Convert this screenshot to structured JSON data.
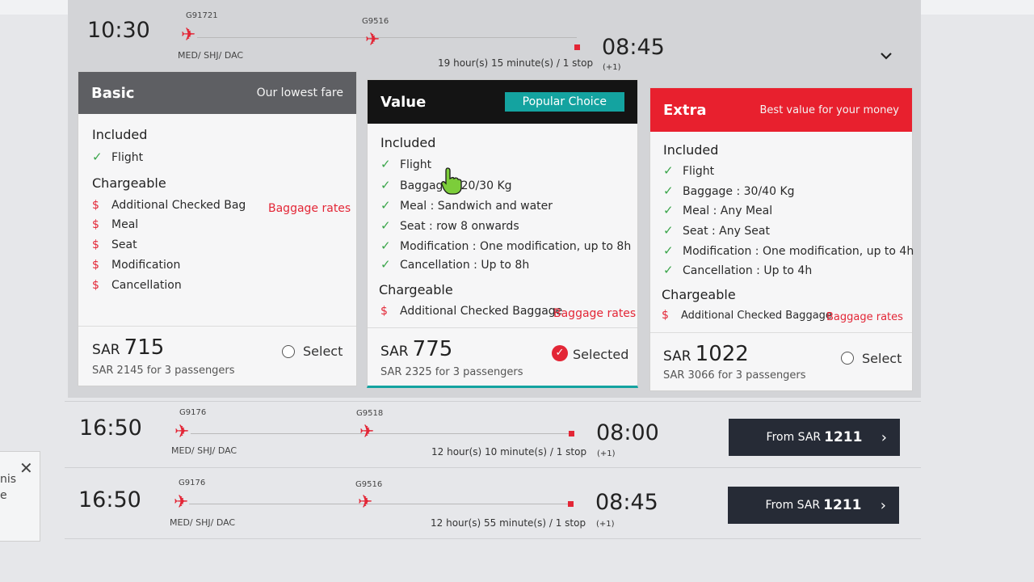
{
  "colors": {
    "accent_red": "#e32636",
    "basic_header": "#5e5f63",
    "value_header": "#141414",
    "extra_header": "#e8202e",
    "badge_teal": "#14a3a0",
    "button_dark": "#262b36",
    "check_green": "#3aa54a"
  },
  "icons": {
    "plane": "plane-icon",
    "check": "check-icon",
    "dollar": "dollar-icon",
    "chevron": "chevron-down-icon",
    "close": "close-icon",
    "arrow": "chevron-right-icon"
  },
  "selected_flight": {
    "dep_time": "10:30",
    "code1": "G91721",
    "code2": "G9516",
    "route": "MED/ SHJ/ DAC",
    "duration": "19 hour(s) 15 minute(s) / 1 stop",
    "arr_time": "08:45",
    "plus_day": "(+1)"
  },
  "fares": {
    "basic": {
      "name": "Basic",
      "tag": "Our lowest fare",
      "included_title": "Included",
      "included": [
        "Flight"
      ],
      "chargeable_title": "Chargeable",
      "chargeable": [
        "Additional Checked Bag",
        "Meal",
        "Seat",
        "Modification",
        "Cancellation"
      ],
      "rates_link": "Baggage rates",
      "currency": "SAR",
      "price": "715",
      "per_passengers": "SAR 2145 for 3 passengers",
      "select_label": "Select"
    },
    "value": {
      "name": "Value",
      "badge": "Popular Choice",
      "included_title": "Included",
      "included": [
        "Flight",
        "Baggage : 20/30 Kg",
        "Meal : Sandwich and water",
        "Seat : row 8 onwards",
        "Modification : One modification, up to 8h",
        "Cancellation : Up to 8h"
      ],
      "chargeable_title": "Chargeable",
      "chargeable": [
        "Additional Checked Baggage"
      ],
      "rates_link": "Baggage rates",
      "currency": "SAR",
      "price": "775",
      "per_passengers": "SAR 2325 for 3 passengers",
      "select_label": "Selected"
    },
    "extra": {
      "name": "Extra",
      "tag": "Best value for your money",
      "included_title": "Included",
      "included": [
        "Flight",
        "Baggage : 30/40 Kg",
        "Meal : Any Meal",
        "Seat : Any Seat",
        "Modification : One modification, up to 4h",
        "Cancellation : Up to 4h"
      ],
      "chargeable_title": "Chargeable",
      "chargeable": [
        "Additional Checked Baggage"
      ],
      "rates_link": "Baggage rates",
      "currency": "SAR",
      "price": "1022",
      "per_passengers": "SAR 3066 for 3 passengers",
      "select_label": "Select"
    }
  },
  "other_flights": [
    {
      "dep_time": "16:50",
      "code1": "G9176",
      "code2": "G9518",
      "route": "MED/ SHJ/ DAC",
      "duration": "12 hour(s) 10 minute(s) / 1 stop",
      "arr_time": "08:00",
      "plus_day": "(+1)",
      "from_label": "From SAR",
      "from_price": "1211"
    },
    {
      "dep_time": "16:50",
      "code1": "G9176",
      "code2": "G9516",
      "route": "MED/ SHJ/ DAC",
      "duration": "12 hour(s) 55 minute(s) / 1 stop",
      "arr_time": "08:45",
      "plus_day": "(+1)",
      "from_label": "From SAR",
      "from_price": "1211"
    }
  ],
  "toast": {
    "text_line1": "nis",
    "text_line2": "e"
  }
}
